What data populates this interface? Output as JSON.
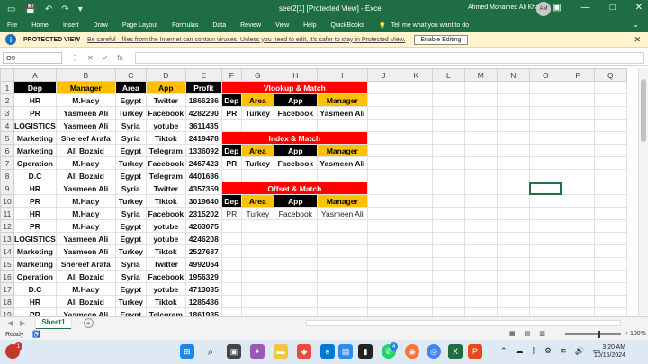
{
  "window": {
    "title": "seet2[1]  [Protected View]  -  Excel",
    "user": "Ahmed Mohamed Ali Khalil",
    "avatar_initials": "AM",
    "accent": "#1f6e43"
  },
  "menu": {
    "tabs": [
      "File",
      "Home",
      "Insert",
      "Draw",
      "Page Layout",
      "Formulas",
      "Data",
      "Review",
      "View",
      "Help",
      "QuickBooks"
    ],
    "tell_me": "Tell me what you want to do"
  },
  "protected_view": {
    "label": "PROTECTED VIEW",
    "message": "Be careful—files from the Internet can contain viruses. Unless you need to edit, it's safer to stay in Protected View.",
    "button": "Enable Editing"
  },
  "formula_bar": {
    "name_box": "O9",
    "fx": "fx",
    "formula": ""
  },
  "columns": [
    "A",
    "B",
    "C",
    "D",
    "E",
    "F",
    "G",
    "H",
    "I",
    "J",
    "K",
    "L",
    "M",
    "N",
    "O",
    "P",
    "Q"
  ],
  "main_table": {
    "headers": [
      "Dep",
      "Manager",
      "Area",
      "App",
      "Profit"
    ],
    "rows": [
      [
        "HR",
        "M.Hady",
        "Egypt",
        "Twitter",
        "1866286"
      ],
      [
        "PR",
        "Yasmeen Ali",
        "Turkey",
        "Facebook",
        "4282290"
      ],
      [
        "LOGISTICS",
        "Yasmeen Ali",
        "Syria",
        "yotube",
        "3611435"
      ],
      [
        "Marketing",
        "Shereef Arafa",
        "Syria",
        "Tiktok",
        "2419478"
      ],
      [
        "Marketing",
        "Ali Bozaid",
        "Egypt",
        "Telegram",
        "1336092"
      ],
      [
        "Operation",
        "M.Hady",
        "Turkey",
        "Facebook",
        "2467423"
      ],
      [
        "D.C",
        "Ali Bozaid",
        "Egypt",
        "Telegram",
        "4401686"
      ],
      [
        "HR",
        "Yasmeen Ali",
        "Syria",
        "Twitter",
        "4357359"
      ],
      [
        "PR",
        "M.Hady",
        "Turkey",
        "Tiktok",
        "3019640"
      ],
      [
        "HR",
        "M.Hady",
        "Syria",
        "Facebook",
        "2315202"
      ],
      [
        "PR",
        "M.Hady",
        "Egypt",
        "yotube",
        "4263075"
      ],
      [
        "LOGISTICS",
        "Yasmeen Ali",
        "Egypt",
        "yotube",
        "4246208"
      ],
      [
        "Marketing",
        "Yasmeen Ali",
        "Turkey",
        "Tiktok",
        "2527687"
      ],
      [
        "Marketing",
        "Shereef Arafa",
        "Syria",
        "Twitter",
        "4992064"
      ],
      [
        "Operation",
        "Ali Bozaid",
        "Syria",
        "Facebook",
        "1956329"
      ],
      [
        "D.C",
        "M.Hady",
        "Egypt",
        "yotube",
        "4713035"
      ],
      [
        "HR",
        "Ali Bozaid",
        "Turkey",
        "Tiktok",
        "1285436"
      ],
      [
        "PR",
        "Yasmeen Ali",
        "Egypt",
        "Telegram",
        "1861935"
      ]
    ]
  },
  "lookup_blocks": [
    {
      "title": "Vlookup & Match",
      "headers": [
        "Dep",
        "Area",
        "App",
        "Manager"
      ],
      "values": [
        "PR",
        "Turkey",
        "Facebook",
        "Yasmeen Ali"
      ],
      "bold": true
    },
    {
      "title": "Index & Match",
      "headers": [
        "Dep",
        "Area",
        "App",
        "Manager"
      ],
      "values": [
        "PR",
        "Turkey",
        "Facebook",
        "Yasmeen Ali"
      ],
      "bold": true
    },
    {
      "title": "Offset & Match",
      "headers": [
        "Dep",
        "Area",
        "App",
        "Manager"
      ],
      "values": [
        "PR",
        "Turkey",
        "Facebook",
        "Yasmeen Ali"
      ],
      "bold": false
    }
  ],
  "selected_cell": "O9",
  "sheet_tabs": [
    "Sheet1"
  ],
  "status": {
    "ready": "Ready",
    "zoom": "100%"
  },
  "clock": {
    "time": "3:20 AM",
    "date": "10/15/2024"
  },
  "taskbar_badges": {
    "notif": "1",
    "whatsapp": "4"
  }
}
